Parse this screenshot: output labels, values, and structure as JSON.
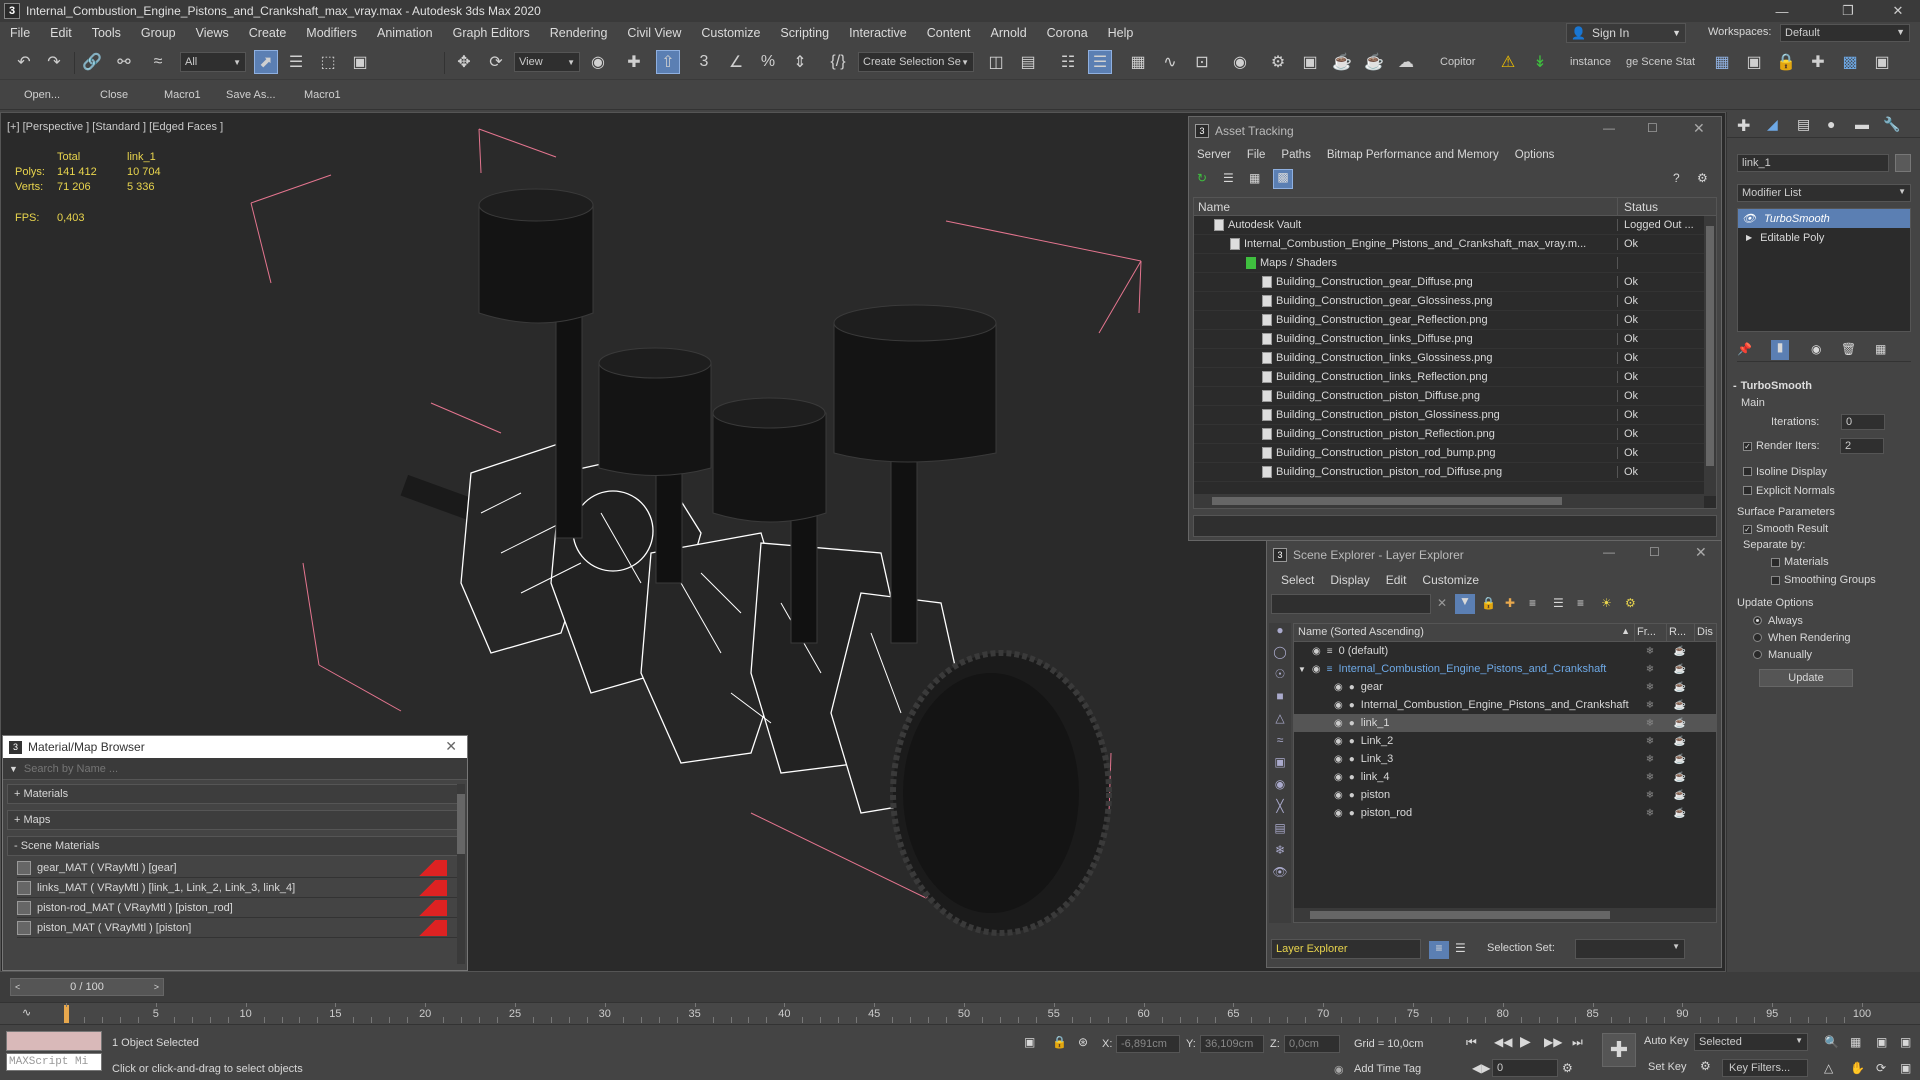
{
  "window": {
    "title": "Internal_Combustion_Engine_Pistons_and_Crankshaft_max_vray.max - Autodesk 3ds Max 2020",
    "app_icon": "3"
  },
  "menu": [
    "File",
    "Edit",
    "Tools",
    "Group",
    "Views",
    "Create",
    "Modifiers",
    "Animation",
    "Graph Editors",
    "Rendering",
    "Civil View",
    "Customize",
    "Scripting",
    "Interactive",
    "Content",
    "Arnold",
    "Corona",
    "Help"
  ],
  "signin": {
    "label": "Sign In"
  },
  "workspaces": {
    "label": "Workspaces:",
    "value": "Default"
  },
  "toolbar": {
    "filter_all": "All",
    "view_select": "View",
    "create_selection_set": "Create Selection Se",
    "copitor": "Copitor",
    "instance": "instance",
    "ge_scene": "ge Scene Stat"
  },
  "toolbar2": {
    "open": "Open...",
    "close": "Close",
    "macro1a": "Macro1",
    "save_as": "Save As...",
    "macro1b": "Macro1"
  },
  "viewport": {
    "label": "[+] [Perspective ] [Standard ] [Edged Faces ]",
    "stats": {
      "total_label": "Total",
      "obj_label": "link_1",
      "polys_label": "Polys:",
      "polys_total": "141 412",
      "polys_obj": "10 704",
      "verts_label": "Verts:",
      "verts_total": "71 206",
      "verts_obj": "5 336",
      "fps_label": "FPS:",
      "fps": "0,403"
    }
  },
  "asset_tracking": {
    "title": "Asset Tracking",
    "menu": [
      "Server",
      "File",
      "Paths",
      "Bitmap Performance and Memory",
      "Options"
    ],
    "col_name": "Name",
    "col_status": "Status",
    "rows": [
      {
        "name": "Autodesk Vault",
        "status": "Logged Out ...",
        "indent": 0
      },
      {
        "name": "Internal_Combustion_Engine_Pistons_and_Crankshaft_max_vray.m...",
        "status": "Ok",
        "indent": 1
      },
      {
        "name": "Maps / Shaders",
        "status": "",
        "indent": 2
      },
      {
        "name": "Building_Construction_gear_Diffuse.png",
        "status": "Ok",
        "indent": 3
      },
      {
        "name": "Building_Construction_gear_Glossiness.png",
        "status": "Ok",
        "indent": 3
      },
      {
        "name": "Building_Construction_gear_Reflection.png",
        "status": "Ok",
        "indent": 3
      },
      {
        "name": "Building_Construction_links_Diffuse.png",
        "status": "Ok",
        "indent": 3
      },
      {
        "name": "Building_Construction_links_Glossiness.png",
        "status": "Ok",
        "indent": 3
      },
      {
        "name": "Building_Construction_links_Reflection.png",
        "status": "Ok",
        "indent": 3
      },
      {
        "name": "Building_Construction_piston_Diffuse.png",
        "status": "Ok",
        "indent": 3
      },
      {
        "name": "Building_Construction_piston_Glossiness.png",
        "status": "Ok",
        "indent": 3
      },
      {
        "name": "Building_Construction_piston_Reflection.png",
        "status": "Ok",
        "indent": 3
      },
      {
        "name": "Building_Construction_piston_rod_bump.png",
        "status": "Ok",
        "indent": 3
      },
      {
        "name": "Building_Construction_piston_rod_Diffuse.png",
        "status": "Ok",
        "indent": 3
      }
    ]
  },
  "scene_explorer": {
    "title": "Scene Explorer - Layer Explorer",
    "menu": [
      "Select",
      "Display",
      "Edit",
      "Customize"
    ],
    "col_name": "Name (Sorted Ascending)",
    "col_fr": "Fr...",
    "col_r": "R...",
    "col_dis": "Dis",
    "rows": [
      {
        "name": "0 (default)",
        "indent": 0,
        "selected": false,
        "highlight": false
      },
      {
        "name": "Internal_Combustion_Engine_Pistons_and_Crankshaft",
        "indent": 0,
        "selected": false,
        "highlight": true
      },
      {
        "name": "gear",
        "indent": 1,
        "selected": false,
        "highlight": false
      },
      {
        "name": "Internal_Combustion_Engine_Pistons_and_Crankshaft",
        "indent": 1,
        "selected": false,
        "highlight": false
      },
      {
        "name": "link_1",
        "indent": 1,
        "selected": true,
        "highlight": false
      },
      {
        "name": "Link_2",
        "indent": 1,
        "selected": false,
        "highlight": false
      },
      {
        "name": "Link_3",
        "indent": 1,
        "selected": false,
        "highlight": false
      },
      {
        "name": "link_4",
        "indent": 1,
        "selected": false,
        "highlight": false
      },
      {
        "name": "piston",
        "indent": 1,
        "selected": false,
        "highlight": false
      },
      {
        "name": "piston_rod",
        "indent": 1,
        "selected": false,
        "highlight": false
      }
    ],
    "footer_mode": "Layer Explorer",
    "selection_set_label": "Selection Set:"
  },
  "material_browser": {
    "title": "Material/Map Browser",
    "search_placeholder": "Search by Name ...",
    "sections": [
      "+ Materials",
      "+ Maps",
      "- Scene Materials"
    ],
    "materials": [
      "gear_MAT ( VRayMtl ) [gear]",
      "links_MAT ( VRayMtl ) [link_1, Link_2, Link_3, link_4]",
      "piston-rod_MAT ( VRayMtl ) [piston_rod]",
      "piston_MAT ( VRayMtl ) [piston]"
    ]
  },
  "command_panel": {
    "object_name": "link_1",
    "modifier_list": "Modifier List",
    "stack": [
      "TurboSmooth",
      "Editable Poly"
    ],
    "rollout_title": "TurboSmooth",
    "main_label": "Main",
    "iterations_label": "Iterations:",
    "iterations_value": "0",
    "render_iters_label": "Render Iters:",
    "render_iters_value": "2",
    "isoline": "Isoline Display",
    "explicit_normals": "Explicit Normals",
    "surface_params": "Surface Parameters",
    "smooth_result": "Smooth Result",
    "separate_by": "Separate by:",
    "materials": "Materials",
    "smoothing_groups": "Smoothing Groups",
    "update_options": "Update Options",
    "always": "Always",
    "when_rendering": "When Rendering",
    "manually": "Manually",
    "update_button": "Update"
  },
  "timeline": {
    "frame_display": "0 / 100",
    "ticks": [
      "5",
      "10",
      "15",
      "20",
      "25",
      "30",
      "35",
      "40",
      "45",
      "50",
      "55",
      "60",
      "65",
      "70",
      "75",
      "80",
      "85",
      "90",
      "95",
      "100"
    ]
  },
  "status": {
    "maxscript": "MAXScript Mi",
    "objects_selected": "1 Object Selected",
    "prompt": "Click or click-and-drag to select objects",
    "x_label": "X:",
    "x_value": "-6,891cm",
    "y_label": "Y:",
    "y_value": "36,109cm",
    "z_label": "Z:",
    "z_value": "0,0cm",
    "grid": "Grid = 10,0cm",
    "add_time_tag": "Add Time Tag",
    "auto_key": "Auto Key",
    "selected": "Selected",
    "set_key": "Set Key",
    "key_filters": "Key Filters...",
    "frame_value": "0"
  },
  "colors": {
    "accent": "#5b7fb3",
    "viewport_bg": "#2a2a2a",
    "stats": "#e8d44d",
    "bbox": "#e4758f",
    "scene_highlight": "#6ea9e6"
  }
}
